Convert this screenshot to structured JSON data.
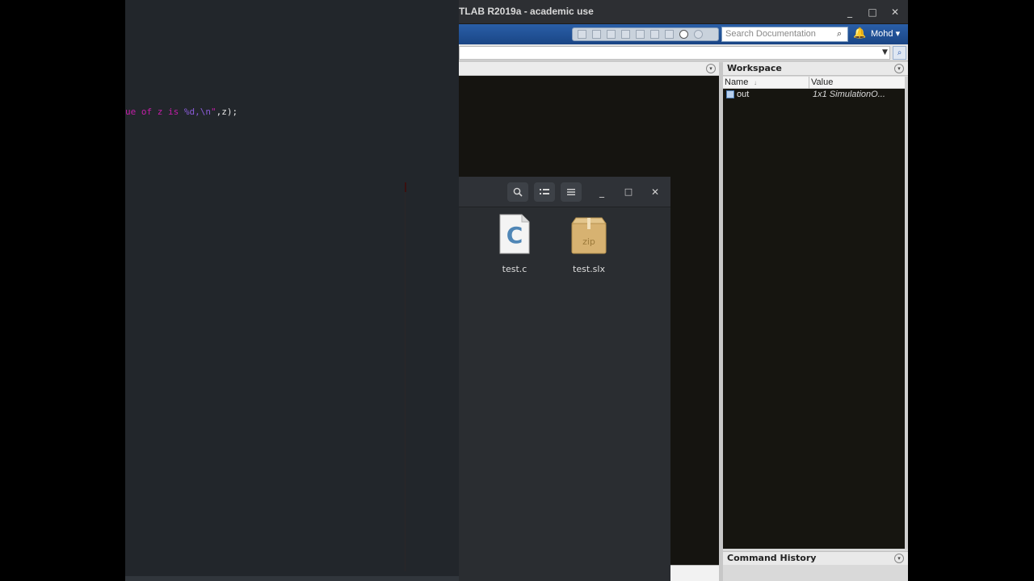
{
  "editor": {
    "code_line": {
      "before": "ue of z is ",
      "format": "%d,\\n",
      "closing_quote": "\"",
      "after": ",z);"
    }
  },
  "matlab": {
    "title": "TLAB R2019a - academic use",
    "window_controls": {
      "minimize": "_",
      "maximize": "□",
      "close": "✕"
    },
    "search": {
      "placeholder": "Search Documentation"
    },
    "user": "Mohd ▾",
    "command_window": {
      "menu_glyph": "▾"
    },
    "workspace": {
      "title": "Workspace",
      "columns": {
        "name": "Name",
        "sort_indicator": "↓",
        "value": "Value"
      },
      "variables": [
        {
          "name": "out",
          "value": "1x1 SimulationO..."
        }
      ]
    },
    "command_history": {
      "title": "Command History"
    }
  },
  "file_manager": {
    "buttons": {
      "search": "🔍",
      "view": "☷",
      "menu": "☰",
      "minimize": "_",
      "maximize": "□",
      "close": "✕"
    },
    "files": [
      {
        "name": "test.c",
        "icon": "c-source-file-icon"
      },
      {
        "name": "test.slx",
        "icon": "zip-archive-icon"
      }
    ]
  },
  "colors": {
    "editor_bg": "#22262b",
    "matlab_toolbar": "#2a5fa8",
    "command_window_bg": "#151410",
    "file_manager_bg": "#2b2e33"
  }
}
